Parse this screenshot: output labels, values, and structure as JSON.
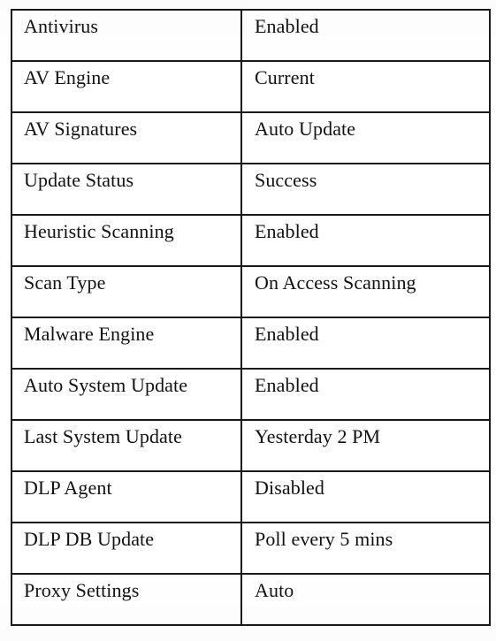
{
  "document": {
    "type": "settings-table",
    "background_color": "#ffffff",
    "text_color": "#111111",
    "border_color": "#1a1a1a"
  },
  "table": {
    "columns": [
      "setting",
      "value"
    ],
    "rows": [
      {
        "setting": "Antivirus",
        "value": "Enabled"
      },
      {
        "setting": "AV Engine",
        "value": "Current"
      },
      {
        "setting": "AV Signatures",
        "value": "Auto Update"
      },
      {
        "setting": "Update Status",
        "value": "Success"
      },
      {
        "setting": "Heuristic Scanning",
        "value": "Enabled"
      },
      {
        "setting": "Scan Type",
        "value": "On Access Scanning"
      },
      {
        "setting": "Malware Engine",
        "value": "Enabled"
      },
      {
        "setting": "Auto System Update",
        "value": "Enabled"
      },
      {
        "setting": "Last System Update",
        "value": "Yesterday 2 PM"
      },
      {
        "setting": "DLP Agent",
        "value": "Disabled"
      },
      {
        "setting": "DLP DB Update",
        "value": "Poll every 5 mins"
      },
      {
        "setting": "Proxy Settings",
        "value": "Auto"
      }
    ]
  }
}
